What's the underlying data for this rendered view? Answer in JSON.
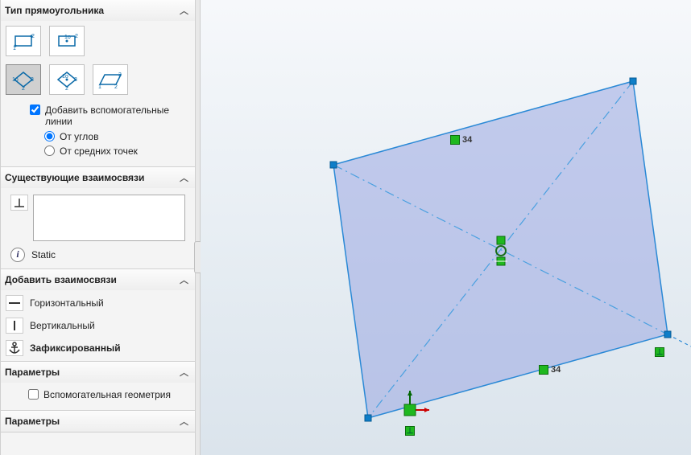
{
  "sidebar": {
    "rect_type": {
      "title": "Тип прямоугольника",
      "tools": [
        "rect-corner",
        "rect-center",
        "rect-3pt-diamond",
        "rect-3pt-center",
        "parallelogram"
      ],
      "selected": "rect-3pt-diamond",
      "add_construction": {
        "label": "Добавить вспомогательные линии",
        "checked": true,
        "radios": {
          "from_corners": "От углов",
          "from_midpoints": "От средних точек",
          "selected": "from_corners"
        }
      }
    },
    "existing_rel": {
      "title": "Существующие взаимосвязи",
      "list": [],
      "static_label": "Static"
    },
    "add_rel": {
      "title": "Добавить взаимосвязи",
      "items": [
        {
          "id": "horizontal",
          "label": "Горизонтальный"
        },
        {
          "id": "vertical",
          "label": "Вертикальный"
        },
        {
          "id": "fixed",
          "label": "Зафиксированный"
        }
      ]
    },
    "params1": {
      "title": "Параметры",
      "aux_geom": {
        "label": "Вспомогательная геометрия",
        "checked": false
      }
    },
    "params2": {
      "title": "Параметры"
    }
  },
  "canvas": {
    "labels": {
      "parallel_top": "34",
      "parallel_bottom": "34"
    }
  }
}
